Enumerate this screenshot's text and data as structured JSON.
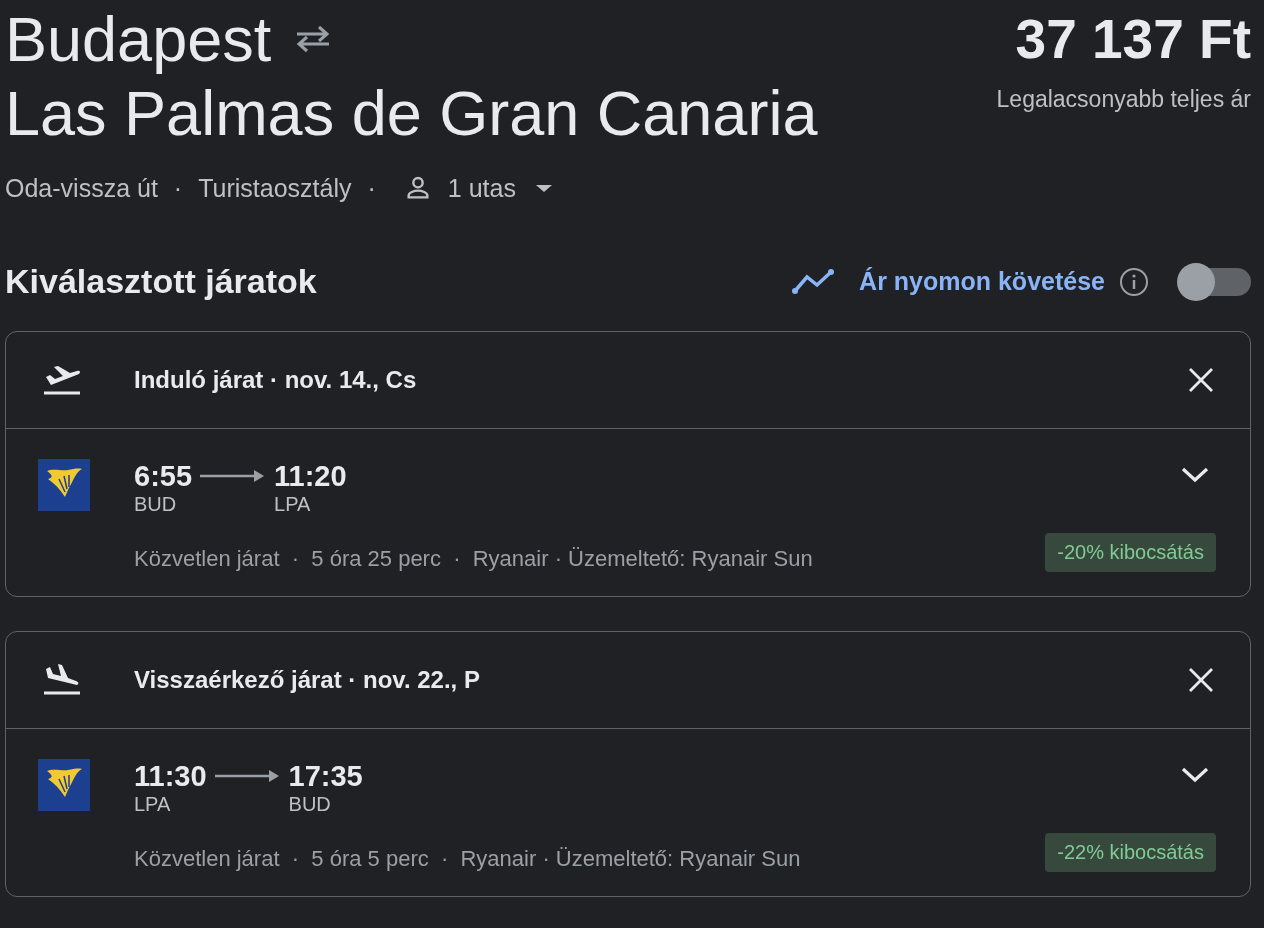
{
  "header": {
    "origin": "Budapest",
    "destination": "Las Palmas de Gran Canaria",
    "price": "37 137 Ft",
    "price_note": "Legalacsonyabb teljes ár"
  },
  "trip": {
    "type": "Oda-vissza út",
    "separator_1": "·",
    "cabin": "Turistaosztály",
    "separator_2": "·",
    "passengers": "1 utas"
  },
  "section": {
    "title": "Kiválasztott járatok"
  },
  "tracking": {
    "label": "Ár nyomon követése",
    "on": false
  },
  "flights": [
    {
      "kind": "departure",
      "title": "Induló járat · nov. 14., Cs",
      "depart_time": "6:55",
      "arrive_time": "11:20",
      "depart_airport": "BUD",
      "arrive_airport": "LPA",
      "details": "Közvetlen járat  ·  5 óra 25 perc  ·  Ryanair · Üzemeltető: Ryanair Sun",
      "emissions": "-20% kibocsátás"
    },
    {
      "kind": "return",
      "title": "Visszaérkező járat · nov. 22., P",
      "depart_time": "11:30",
      "arrive_time": "17:35",
      "depart_airport": "LPA",
      "arrive_airport": "BUD",
      "details": "Közvetlen járat  ·  5 óra 5 perc  ·  Ryanair · Üzemeltető: Ryanair Sun",
      "emissions": "-22% kibocsátás"
    }
  ]
}
